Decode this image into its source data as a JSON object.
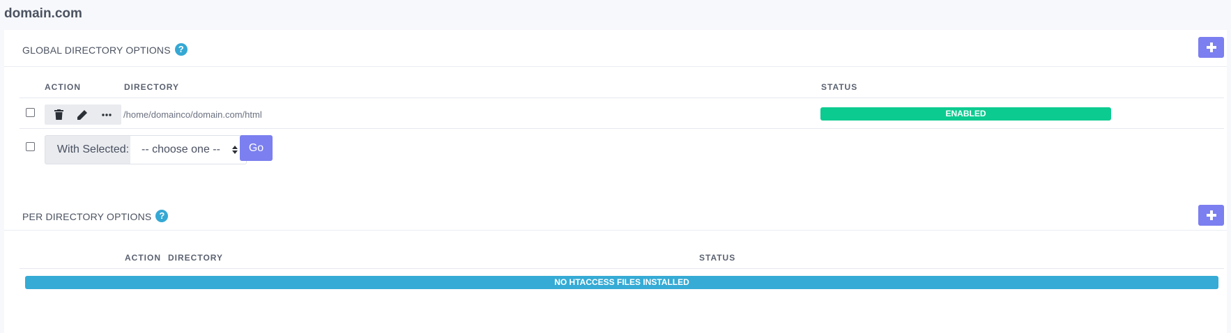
{
  "page": {
    "title": "domain.com"
  },
  "global_section": {
    "title": "GLOBAL DIRECTORY OPTIONS",
    "help_symbol": "?",
    "columns": {
      "action": "ACTION",
      "directory": "DIRECTORY",
      "status": "STATUS"
    },
    "rows": [
      {
        "directory": "/home/domainco/domain.com/html",
        "status": "ENABLED"
      }
    ],
    "bulk": {
      "label": "With Selected:",
      "select_value": "-- choose one --",
      "go_label": "Go"
    }
  },
  "per_dir_section": {
    "title": "PER DIRECTORY OPTIONS",
    "help_symbol": "?",
    "columns": {
      "action": "ACTION",
      "directory": "DIRECTORY",
      "status": "STATUS"
    },
    "empty_message": "NO HTACCESS FILES INSTALLED"
  },
  "icons": {
    "help": "question-circle-icon",
    "add": "plus-icon",
    "delete": "trash-icon",
    "edit": "pencil-icon",
    "more": "ellipsis-icon",
    "select_arrows": "sort-arrows-icon"
  },
  "colors": {
    "accent": "#7b7fef",
    "enabled": "#0ccb90",
    "info": "#35abd5",
    "background": "#f7f8fc"
  }
}
